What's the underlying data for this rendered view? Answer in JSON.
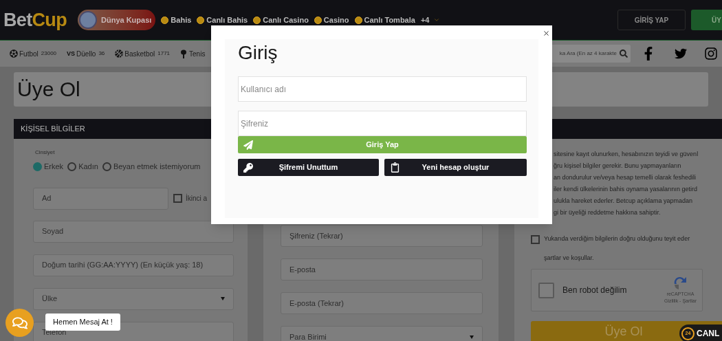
{
  "header": {
    "logo": [
      "Bet",
      "Cup"
    ],
    "featured": "Dünya Kupası",
    "nav": [
      {
        "label": "Bahis"
      },
      {
        "label": "Canlı Bahis"
      },
      {
        "label": "Canlı Casino"
      },
      {
        "label": "Casino"
      },
      {
        "label": "Canlı Tombala"
      }
    ],
    "more": "+4",
    "buttons": [
      {
        "label": "GİRİŞ YAP",
        "kind": "outline"
      },
      {
        "label": "ÜY",
        "kind": "filled"
      }
    ]
  },
  "sports_bar": {
    "items": [
      {
        "label": "Futbol",
        "count": "23000"
      },
      {
        "label": "Düello",
        "count": "36",
        "icon_text": "VS"
      },
      {
        "label": "Basketbol",
        "count": "1771"
      },
      {
        "label": "Tenis"
      }
    ],
    "search": {
      "placeholder": "ka Ara (En az 4 karakte"
    }
  },
  "page": {
    "title": "Üye Ol"
  },
  "personal": {
    "header": "KİŞİSEL BİLGİLER",
    "gender_label": "Cinsiyet",
    "genders": [
      {
        "label": "Erkek",
        "selected": true
      },
      {
        "label": "Kadın",
        "selected": false
      },
      {
        "label": "Beyan etmek istemiyorum",
        "selected": false
      }
    ],
    "name_field": {
      "placeholder": "Ad"
    },
    "second_name": {
      "label": "İkinci a",
      "checked": false
    },
    "fields": [
      {
        "placeholder": "Soyad",
        "kind": "text"
      },
      {
        "placeholder": "Doğum tarihi (GG:AA:YYYY) (En küçük yaş: 18)",
        "kind": "text"
      },
      {
        "placeholder": "Ülke",
        "kind": "select"
      },
      {
        "placeholder": "Telefon",
        "kind": "text"
      }
    ]
  },
  "account": {
    "fields": [
      {
        "placeholder": "Şifreniz (Tekrar)",
        "kind": "text"
      },
      {
        "placeholder": "E-posta",
        "kind": "text"
      },
      {
        "placeholder": "E-posta (Tekrar)",
        "kind": "text"
      },
      {
        "placeholder": "Para Birimi",
        "kind": "select"
      }
    ]
  },
  "terms": {
    "lines": [
      "sitesine kayıt olunurken, hesabınızın teyidi ve güvenl",
      "ğru kişisel bilgiler gerekir. Bunu yapmayanların",
      "an dondurulur ve/veya hesap temelli olarak feshedili",
      "iler kendi ülkelerinin bahis oynama yasalarının getird",
      "ulukla hareket ederler. Betcup açıklama yapmadan",
      "gi bir üyeliği reddetme hakkına sahiptir."
    ],
    "agree": {
      "lines": [
        "Yukarıda verdiğim bilgilerin doğru olduğunu teyit eder",
        "şartlar ve koşullar."
      ],
      "checked": false
    },
    "captcha": {
      "label": "Ben robot değilim",
      "checked": false,
      "brand": "reCAPTCHA",
      "links": "Gizlilik - Şartlar"
    },
    "submit": "Üye Ol"
  },
  "modal": {
    "title": "Giriş",
    "fields": [
      {
        "placeholder": "Kullanıcı adı"
      },
      {
        "placeholder": "Şifreniz"
      }
    ],
    "submit": "Giriş Yap",
    "links": [
      {
        "label": "Şifremi Unuttum",
        "kind": "key"
      },
      {
        "label": "Yeni hesap oluştur",
        "kind": "clipboard"
      }
    ]
  },
  "chat": {
    "tooltip": "Hemen Mesaj At !"
  },
  "live_badge": {
    "number": "24",
    "label": "CANL"
  }
}
